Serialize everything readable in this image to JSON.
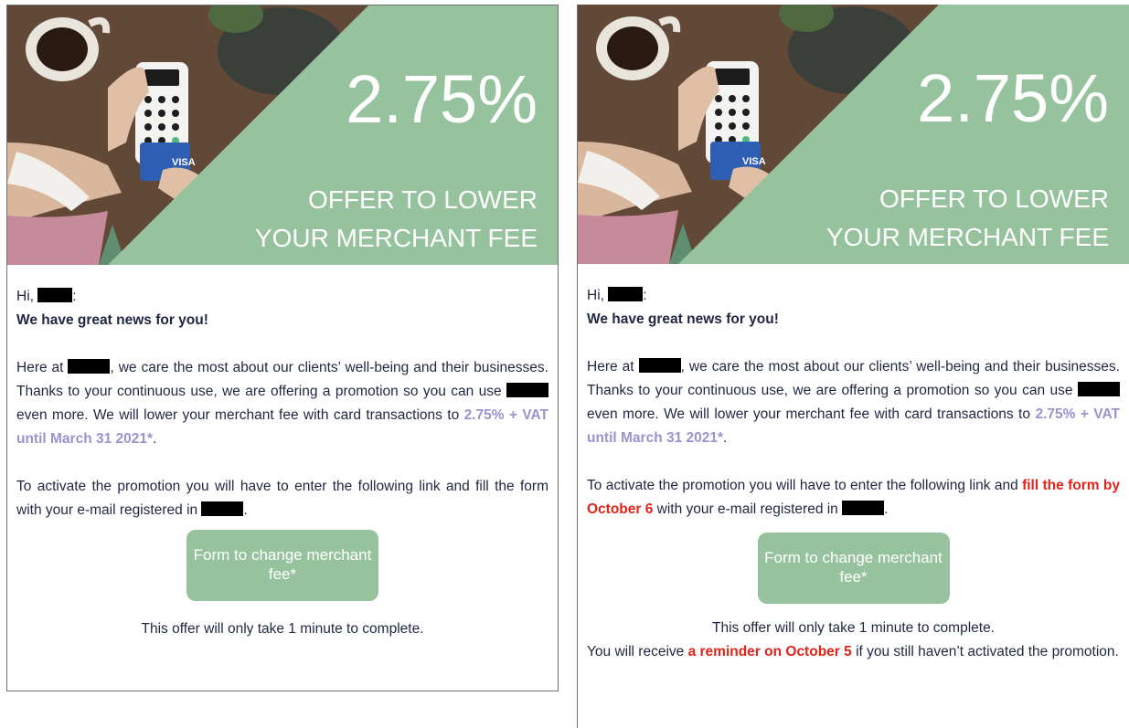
{
  "hero": {
    "percent": "2.75%",
    "offer_line1": "OFFER TO LOWER",
    "offer_line2": "YOUR MERCHANT FEE",
    "card_brand": "VISA",
    "accent_color": "#96c39e"
  },
  "left": {
    "greeting_prefix": "Hi,",
    "greeting_suffix": ":",
    "headline": "We have great news for you!",
    "p1_a": "Here at",
    "p1_b": ", we care the most about our clients’ well-being and their businesses. Thanks to your continuous use, we are offering a promotion so you can use",
    "p1_c": "even more. We will lower your merchant fee with card transactions to",
    "p1_promo": "2.75% + VAT until March 31 2021*",
    "p1_end": ".",
    "p2_a": "To activate the promotion you will have to enter the following link and fill the form with your e-mail registered in",
    "p2_end": ".",
    "button_label": "Form to change merchant fee*",
    "footer": "This offer will only take 1 minute to complete."
  },
  "right": {
    "greeting_prefix": "Hi,",
    "greeting_suffix": ":",
    "headline": "We have great news for you!",
    "p1_a": "Here at",
    "p1_b": ", we care the most about our clients’ well-being and their businesses. Thanks to your continuous use, we are offering a promotion so you can use",
    "p1_c": "even more. We will lower your merchant fee with card transactions to",
    "p1_promo": "2.75% + VAT until March 31 2021*",
    "p1_end": ".",
    "p2_a": "To activate the promotion you will have to enter the following link and",
    "p2_red": "fill the form by October 6",
    "p2_b": "with your e-mail registered in",
    "p2_end": ".",
    "button_label": "Form to change merchant fee*",
    "footer": "This offer will only take 1 minute to complete.",
    "reminder_a": "You will receive",
    "reminder_red": "a reminder on October 5",
    "reminder_b": "if you still haven’t activated the promotion."
  }
}
